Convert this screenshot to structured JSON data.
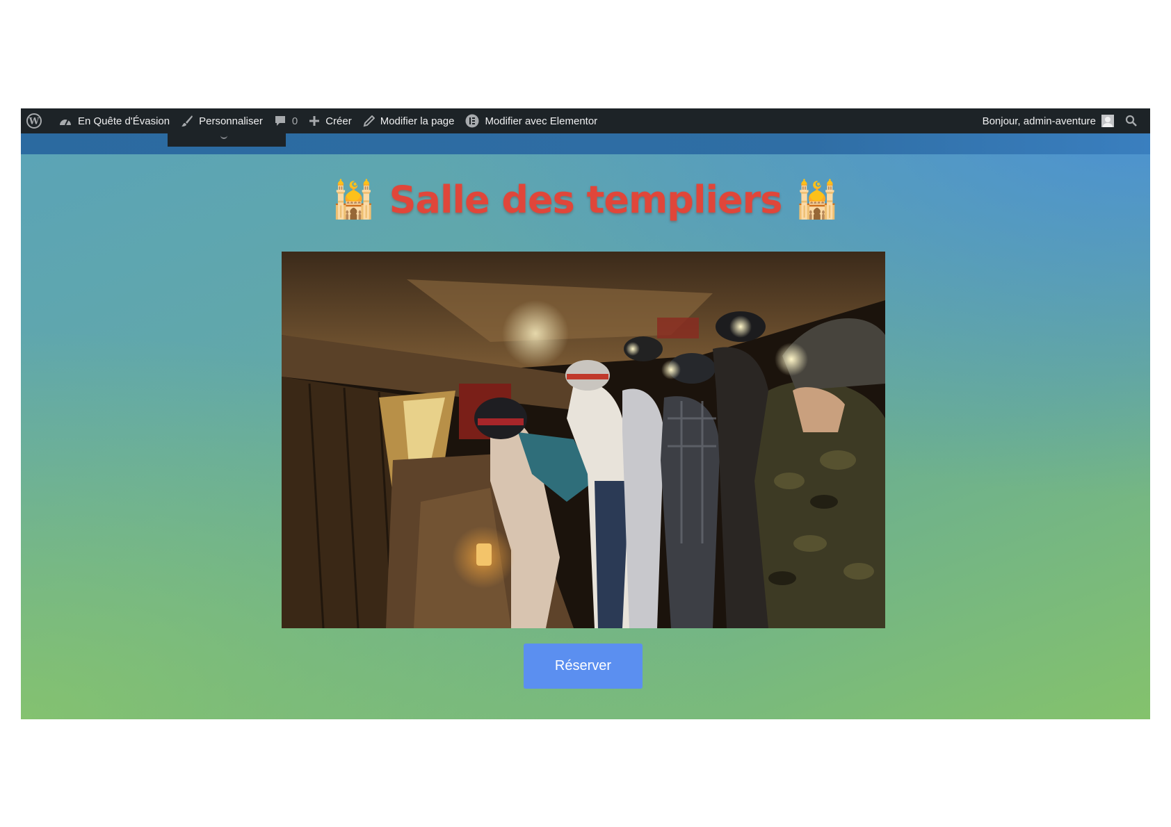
{
  "adminbar": {
    "site_name": "En Quête d'Évasion",
    "customize": "Personnaliser",
    "comments_count": "0",
    "new": "Créer",
    "edit_page": "Modifier la page",
    "edit_elementor": "Modifier avec Elementor",
    "greeting": "Bonjour, admin-aventure",
    "icons": [
      "wordpress-logo-icon",
      "dashboard-icon",
      "brush-icon",
      "comment-icon",
      "plus-icon",
      "pencil-icon",
      "elementor-icon",
      "avatar",
      "search-icon"
    ]
  },
  "main": {
    "title_emoji": "🕌",
    "title": "Salle des templiers",
    "button_label": "Réserver"
  },
  "colors": {
    "adminbar_bg": "#1d2327",
    "title": "#e0463a",
    "button": "#5b8ff0"
  }
}
